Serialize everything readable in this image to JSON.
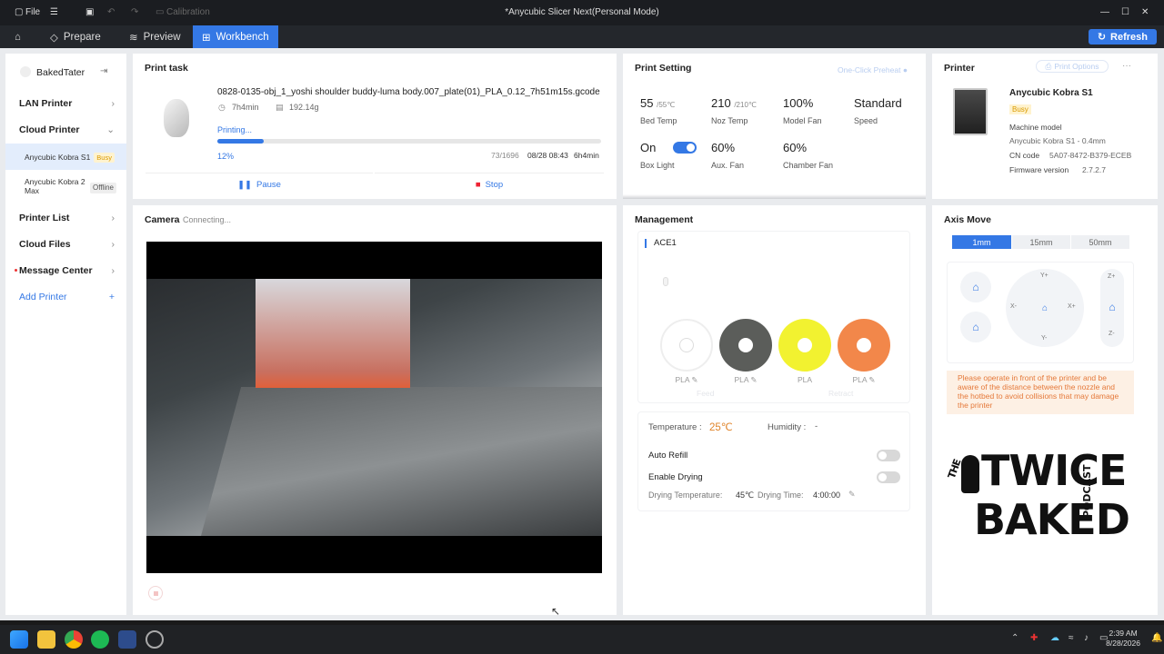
{
  "window": {
    "file_label": "File",
    "calibration_label": "Calibration",
    "title": "*Anycubic Slicer Next(Personal Mode)"
  },
  "nav": {
    "tabs": [
      {
        "label": "Prepare"
      },
      {
        "label": "Preview"
      },
      {
        "label": "Workbench"
      }
    ],
    "refresh_label": "Refresh"
  },
  "sidebar": {
    "username": "BakedTater",
    "lan_printer": "LAN Printer",
    "cloud_printer": "Cloud Printer",
    "printers": [
      {
        "name": "Anycubic Kobra S1",
        "status": "Busy"
      },
      {
        "name": "Anycubic Kobra 2 Max",
        "status": "Offline"
      }
    ],
    "printer_list": "Printer List",
    "cloud_files": "Cloud Files",
    "message_center": "Message Center",
    "add_printer": "Add Printer"
  },
  "print_task": {
    "title": "Print task",
    "filename": "0828-0135-obj_1_yoshi shoulder buddy-luma body.007_plate(01)_PLA_0.12_7h51m15s.gcode",
    "duration": "7h4min",
    "weight": "192.14g",
    "status": "Printing...",
    "progress_label": "12%",
    "progress": 0.12,
    "layers": "73/1696",
    "eta_date": "08/28 08:43",
    "remaining": "6h4min",
    "pause_label": "Pause",
    "stop_label": "Stop"
  },
  "camera": {
    "title": "Camera",
    "status": "Connecting..."
  },
  "print_setting": {
    "title": "Print Setting",
    "preheat_label": "One-Click Preheat",
    "bed_temp": "55",
    "bed_temp_target": "/55℃",
    "bed_temp_label": "Bed Temp",
    "noz_temp": "210",
    "noz_temp_target": "/210℃",
    "noz_temp_label": "Noz Temp",
    "model_fan": "100%",
    "model_fan_label": "Model Fan",
    "speed": "Standard",
    "speed_label": "Speed",
    "box_light": "On",
    "box_light_label": "Box Light",
    "aux_fan": "60%",
    "aux_fan_label": "Aux. Fan",
    "chamber_fan": "60%",
    "chamber_fan_label": "Chamber Fan"
  },
  "printer": {
    "title": "Printer",
    "options_label": "Print Options",
    "name": "Anycubic Kobra S1",
    "status": "Busy",
    "machine_model_label": "Machine model",
    "machine_model": "Anycubic Kobra S1 - 0.4mm",
    "cn_code_label": "CN code",
    "cn_code": "5A07-8472-B379-ECEB",
    "firmware_label": "Firmware version",
    "firmware": "2.7.2.7"
  },
  "management": {
    "title": "Management",
    "ace_label": "ACE1",
    "spools": [
      {
        "label": "PLA",
        "color": "#ffffff"
      },
      {
        "label": "PLA",
        "color": "#5b5d5a"
      },
      {
        "label": "PLA",
        "color": "#f2f230"
      },
      {
        "label": "PLA",
        "color": "#f2874a"
      }
    ],
    "feed_label": "Feed",
    "retract_label": "Retract",
    "temperature_label": "Temperature :",
    "temperature": "25℃",
    "humidity_label": "Humidity :",
    "humidity": "-",
    "auto_refill_label": "Auto Refill",
    "enable_drying_label": "Enable Drying",
    "drying_temp_label": "Drying Temperature:",
    "drying_temp": "45℃",
    "drying_time_label": "Drying Time:",
    "drying_time": "4:00:00"
  },
  "axis_move": {
    "title": "Axis Move",
    "steps": [
      "1mm",
      "15mm",
      "50mm"
    ],
    "warning": "Please operate in front of the printer and be aware of the distance between the nozzle and the hotbed to avoid collisions that may damage the printer"
  },
  "logo": {
    "the": "THE",
    "twice": "TWICE",
    "baked": "BAKED",
    "podcast": "PODCAST"
  },
  "taskbar": {
    "time": "2:39 AM",
    "date": "8/28/2026"
  },
  "colors": {
    "accent": "#3478e5",
    "busy": "#d99a00",
    "temp": "#e0842a",
    "warning_bg": "#fdf0e4",
    "warning_text": "#e5793a"
  }
}
